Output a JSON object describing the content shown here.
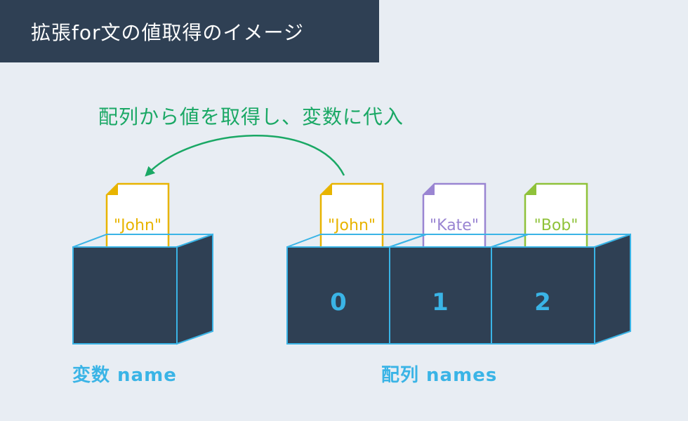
{
  "title": "拡張for文の値取得のイメージ",
  "caption": "配列から値を取得し、変数に代入",
  "variable": {
    "label": "変数 name",
    "card_text": "\"John\"",
    "card_color": "#e8b400"
  },
  "array": {
    "label": "配列 names",
    "cells": [
      {
        "index": "0",
        "card_text": "\"John\"",
        "card_color": "#e8b400"
      },
      {
        "index": "1",
        "card_text": "\"Kate\"",
        "card_color": "#9a85d2"
      },
      {
        "index": "2",
        "card_text": "\"Bob\"",
        "card_color": "#8fc23a"
      }
    ]
  },
  "colors": {
    "background": "#e8edf3",
    "banner": "#2f4054",
    "box_fill": "#2f4054",
    "box_edge": "#3ab4e6",
    "arrow": "#1aa865",
    "label": "#3ab4e6"
  }
}
